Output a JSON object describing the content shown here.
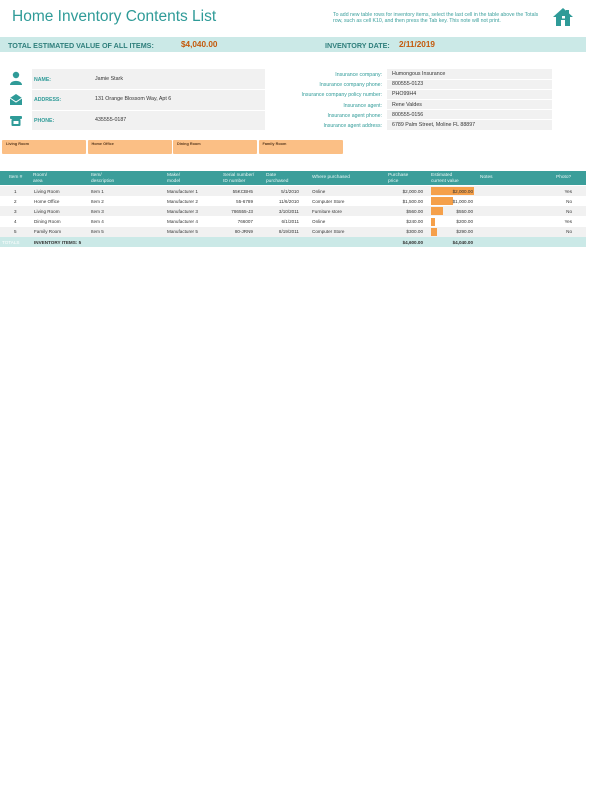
{
  "header": {
    "title": "Home Inventory Contents List",
    "note": "To add new table rows for inventory items, select the last cell in the table above the Totals row, such as cell K10, and then press the Tab key. This note will not print."
  },
  "summary": {
    "total_label": "TOTAL ESTIMATED VALUE OF ALL ITEMS:",
    "total_value": "$4,040.00",
    "date_label": "INVENTORY DATE:",
    "date_value": "2/11/2019"
  },
  "owner": {
    "name_label": "NAME:",
    "name": "Jamie Stark",
    "address_label": "ADDRESS:",
    "address": "131 Orange Blossom Way, Apt 6",
    "phone_label": "PHONE:",
    "phone": "435555-0187"
  },
  "insurance": [
    {
      "label": "Insurance company:",
      "value": "Humongous Insurance"
    },
    {
      "label": "Insurance company phone:",
      "value": "800555-0123"
    },
    {
      "label": "Insurance company policy number:",
      "value": "PHO99H4"
    },
    {
      "label": "Insurance agent:",
      "value": "Rene Valdes"
    },
    {
      "label": "Insurance agent phone:",
      "value": "800555-0156"
    },
    {
      "label": "Insurance agent address:",
      "value": "6789 Palm Street, Moline FL 88897"
    }
  ],
  "rooms": [
    "Living Room",
    "Home Office",
    "Dining Room",
    "Family Room"
  ],
  "table": {
    "headers": {
      "item": "Item #",
      "room": "Room/\narea",
      "desc": "Item/\ndescription",
      "make": "Make/\nmodel",
      "serial": "Serial number/\nID number",
      "date": "Date\npurchased",
      "where": "Where purchased",
      "price": "Purchase\nprice",
      "est": "Estimated\ncurrent value",
      "notes": "Notes",
      "photo": "Photo?"
    },
    "rows": [
      {
        "item": "1",
        "room": "Living Room",
        "desc": "Item 1",
        "make": "Manufacturer 1",
        "serial": "55KCBH5",
        "date": "5/1/2010",
        "where": "Online",
        "price": "$2,000.00",
        "est": "$2,000.00",
        "est_value": 2000,
        "photo": "Yes"
      },
      {
        "item": "2",
        "room": "Home Office",
        "desc": "Item 2",
        "make": "Manufacturer 2",
        "serial": "55-6789",
        "date": "11/6/2010",
        "where": "Computer Store",
        "price": "$1,500.00",
        "est": "$1,000.00",
        "est_value": 1000,
        "photo": "No"
      },
      {
        "item": "3",
        "room": "Living Room",
        "desc": "Item 3",
        "make": "Manufacturer 3",
        "serial": "786555-J3",
        "date": "3/10/2011",
        "where": "Furniture store",
        "price": "$560.00",
        "est": "$550.00",
        "est_value": 550,
        "photo": "No"
      },
      {
        "item": "4",
        "room": "Dining Room",
        "desc": "Item 4",
        "make": "Manufacturer 4",
        "serial": "766007",
        "date": "6/1/2011",
        "where": "Online",
        "price": "$240.00",
        "est": "$200.00",
        "est_value": 200,
        "photo": "Yes"
      },
      {
        "item": "5",
        "room": "Family Room",
        "desc": "Item 5",
        "make": "Manufacturer 5",
        "serial": "80-JRN9",
        "date": "8/19/2011",
        "where": "Computer Store",
        "price": "$300.00",
        "est": "$290.00",
        "est_value": 290,
        "photo": "No"
      }
    ],
    "totals": {
      "label": "TOTALS",
      "count_label": "INVENTORY ITEMS: 5",
      "price": "$4,600.00",
      "est": "$4,040.00"
    }
  },
  "colors": {
    "accent": "#3b9e9a",
    "light_accent": "#cbe9e7",
    "value_orange": "#c45a0c",
    "bar_orange": "#f5a04a",
    "room_tab": "#fbbf85"
  },
  "icons": [
    "house-icon",
    "person-icon",
    "envelope-icon",
    "phone-icon"
  ]
}
